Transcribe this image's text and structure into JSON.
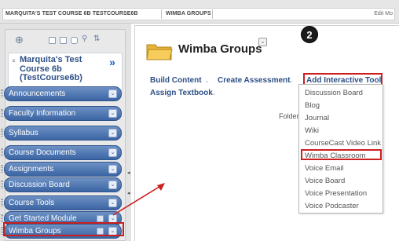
{
  "breadcrumb": {
    "items": [
      "MARQUITA'S TEST COURSE 6B TESTCOURSE6B",
      "WIMBA GROUPS"
    ],
    "edit_mode": "Edit Mo"
  },
  "sidebar": {
    "course_title": "Marquita's Test Course 6b (TestCourse6b)",
    "collapse_icon": "double-chevron-right",
    "items": [
      {
        "label": "Announcements"
      },
      {
        "label": "Faculty Information"
      },
      {
        "label": "Syllabus"
      },
      {
        "label": "Course Documents"
      },
      {
        "label": "Assignments"
      },
      {
        "label": "Discussion Board"
      },
      {
        "label": "Course Tools"
      },
      {
        "label": "Get Started Module"
      },
      {
        "label": "Wimba Groups"
      }
    ]
  },
  "main": {
    "title": "Wimba Groups",
    "step_number": "2",
    "actions": [
      "Build Content",
      "Create Assessment",
      "Add Interactive Tool",
      "Assign Textbook"
    ],
    "folder_text": "Folder",
    "dropdown": [
      "Discussion Board",
      "Blog",
      "Journal",
      "Wiki",
      "CourseCast Video Link",
      "Wimba Classroom",
      "Voice Email",
      "Voice Board",
      "Voice Presentation",
      "Voice Podcaster"
    ]
  },
  "colors": {
    "menu_blue": "#3b64a3",
    "link_blue": "#2d4f86",
    "highlight_red": "#cc1f1f"
  }
}
